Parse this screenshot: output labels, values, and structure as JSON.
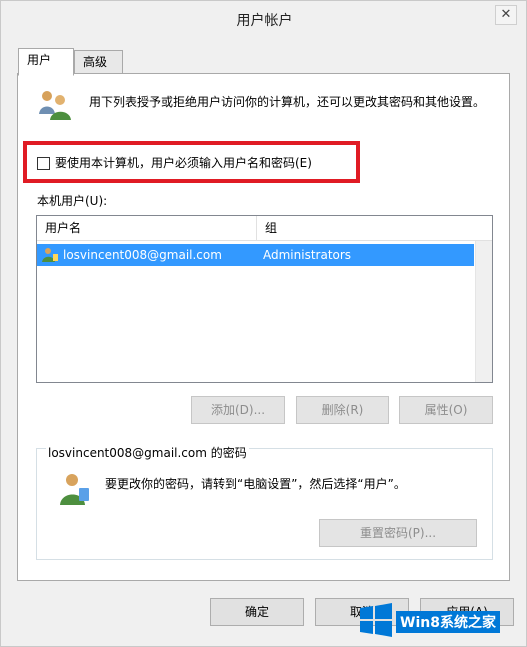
{
  "window": {
    "title": "用户帐户",
    "close_glyph": "✕"
  },
  "tabs": [
    {
      "label": "用户",
      "active": true
    },
    {
      "label": "高级",
      "active": false
    }
  ],
  "intro": {
    "text": "用下列表授予或拒绝用户访问你的计算机，还可以更改其密码和其他设置。",
    "icon": "users-icon"
  },
  "require_login": {
    "label": "要使用本计算机，用户必须输入用户名和密码(E)",
    "checked": false,
    "highlight_color": "#e01b24"
  },
  "users_list": {
    "label": "本机用户(U):",
    "headers": [
      "用户名",
      "组"
    ],
    "rows": [
      {
        "user": "losvincent008@gmail.com",
        "group": "Administrators",
        "selected": true
      }
    ]
  },
  "actions": {
    "add": "添加(D)...",
    "remove": "删除(R)",
    "properties": "属性(O)"
  },
  "password_group": {
    "title": "losvincent008@gmail.com 的密码",
    "message": "要更改你的密码，请转到“电脑设置”，然后选择“用户”。",
    "reset": "重置密码(P)..."
  },
  "dialog_buttons": {
    "ok": "确定",
    "cancel": "取消",
    "apply": "应用(A)"
  },
  "watermark": {
    "text": "Win8系统之家",
    "color": "#0078d7"
  }
}
